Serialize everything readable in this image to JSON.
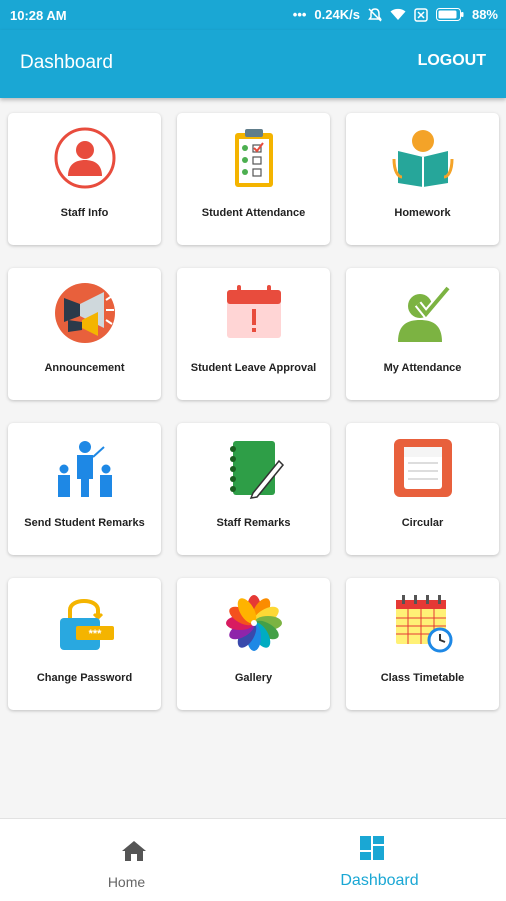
{
  "status_bar": {
    "time": "10:28 AM",
    "dots": "•••",
    "speed": "0.24K/s",
    "battery": "88%"
  },
  "app_bar": {
    "title": "Dashboard",
    "logout_label": "LOGOUT"
  },
  "tiles": [
    {
      "label": "Staff Info",
      "icon": "staff-info-icon"
    },
    {
      "label": "Student Attendance",
      "icon": "attendance-clipboard-icon"
    },
    {
      "label": "Homework",
      "icon": "homework-book-icon"
    },
    {
      "label": "Announcement",
      "icon": "megaphone-icon"
    },
    {
      "label": "Student Leave Approval",
      "icon": "calendar-alert-icon"
    },
    {
      "label": "My Attendance",
      "icon": "user-check-icon"
    },
    {
      "label": "Send Student Remarks",
      "icon": "teacher-students-icon"
    },
    {
      "label": "Staff Remarks",
      "icon": "notebook-pen-icon"
    },
    {
      "label": "Circular",
      "icon": "circular-notepad-icon"
    },
    {
      "label": "Change Password",
      "icon": "password-lock-icon"
    },
    {
      "label": "Gallery",
      "icon": "gallery-flower-icon"
    },
    {
      "label": "Class Timetable",
      "icon": "timetable-calendar-icon"
    }
  ],
  "bottom_nav": {
    "home_label": "Home",
    "dashboard_label": "Dashboard",
    "active": "Dashboard",
    "active_color": "#1aa7d4",
    "inactive_color": "#666666"
  },
  "colors": {
    "primary": "#1aa7d4"
  }
}
